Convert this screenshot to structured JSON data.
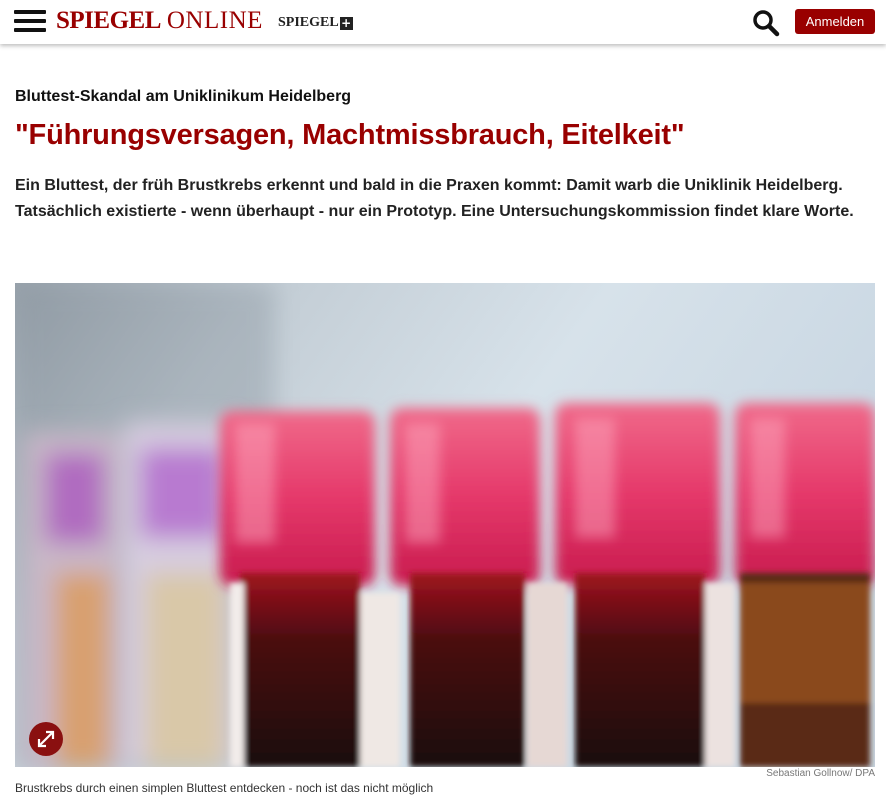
{
  "header": {
    "logo_main": "SPIEGEL",
    "logo_sub": "ONLINE",
    "plus_logo": "SPIEGEL",
    "plus_symbol": "+",
    "login_label": "Anmelden",
    "icons": [
      "hamburger-menu-icon",
      "search-icon",
      "expand-icon"
    ],
    "brand_color": "#990000"
  },
  "article": {
    "kicker": "Bluttest-Skandal am Uniklinikum Heidelberg",
    "headline": "\"Führungsversagen, Machtmissbrauch, Eitelkeit\"",
    "teaser": "Ein Bluttest, der früh Brustkrebs erkennt und bald in die Praxen kommt: Damit warb die Uniklinik Heidelberg. Tatsächlich existierte - wenn überhaupt - nur ein Prototyp. Eine Untersuchungskommission findet klare Worte.",
    "image": {
      "credit": "Sebastian Gollnow/ DPA",
      "caption": "Brustkrebs durch einen simplen Bluttest entdecken - noch ist das nicht möglich"
    }
  }
}
